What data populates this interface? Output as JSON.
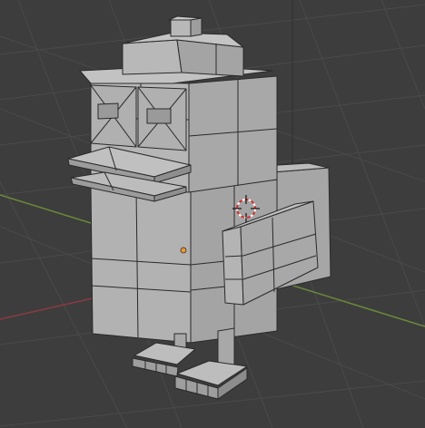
{
  "viewport": {
    "background": "#3d3d3d",
    "grid_color": "#484848",
    "x_axis_color": "#8a3a44",
    "y_axis_color": "#6b8a3a",
    "z_axis_color": "#2f2f2f",
    "mesh_fill_light": "#b4b4b4",
    "mesh_fill_mid": "#a2a2a2",
    "mesh_fill_dark": "#8e8e8e",
    "edge_color": "#2a2a2a",
    "origin_color": "#e8983c"
  },
  "scene": {
    "object": "duck-mesh",
    "cursor_icon": "3d-cursor-icon",
    "origin_icon": "object-origin-icon"
  }
}
